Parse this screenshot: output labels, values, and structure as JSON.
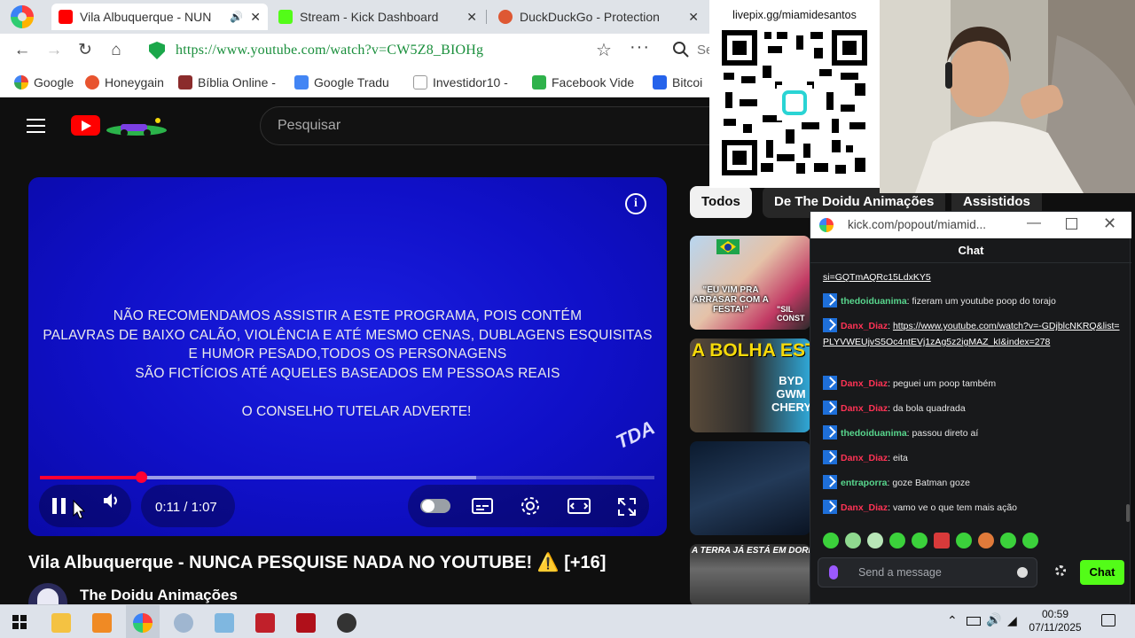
{
  "browser": {
    "tabs": [
      {
        "title": "Vila Albuquerque - NUN"
      },
      {
        "title": "Stream - Kick Dashboard"
      },
      {
        "title": "DuckDuckGo - Protection"
      }
    ],
    "url": "https://www.youtube.com/watch?v=CW5Z8_BIOHg",
    "search_partial": "Se",
    "bookmarks": [
      {
        "label": "Google"
      },
      {
        "label": "Honeygain"
      },
      {
        "label": "Bíblia Online -"
      },
      {
        "label": "Google Tradu"
      },
      {
        "label": "Investidor10 -"
      },
      {
        "label": "Facebook Vide"
      },
      {
        "label": "Bitcoi"
      }
    ]
  },
  "youtube": {
    "search_placeholder": "Pesquisar",
    "video": {
      "disclaimer_lines": [
        "NÃO RECOMENDAMOS ASSISTIR A ESTE PROGRAMA, POIS CONTÉM",
        "PALAVRAS DE BAIXO CALÃO, VIOLÊNCIA E ATÉ MESMO CENAS, DUBLAGENS ESQUISITAS",
        "E HUMOR PESADO,TODOS OS PERSONAGENS",
        "SÃO FICTÍCIOS ATÉ AQUELES BASEADOS EM PESSOAS REAIS"
      ],
      "warning": "O CONSELHO TUTELAR ADVERTE!",
      "watermark": "TDA",
      "time": "0:11 / 1:07",
      "played_fraction": 0.164,
      "buffered_fraction": 0.71
    },
    "title": "Vila Albuquerque - NUNCA PESQUISE NADA NO YOUTUBE! ⚠️ [+16]",
    "channel": "The Doidu Animações",
    "chips": [
      "Todos",
      "De The Doidu Animações",
      "Assistidos"
    ],
    "thumbs": [
      {
        "caption": "\"EU VIM PRA ARRASAR COM A FESTA!\"",
        "side": "\"SIL CONST"
      },
      {
        "caption": "A BOLHA ESTOU",
        "side": "BYD GWM CHERY"
      },
      {
        "caption": ""
      },
      {
        "caption": "A TERRA JÁ ESTÁ EM DORES"
      }
    ]
  },
  "overlay": {
    "qr_label": "livepix.gg/miamidesantos"
  },
  "kick_chat": {
    "url": "kick.com/popout/miamid...",
    "header": "Chat",
    "messages": [
      {
        "user": "",
        "text": "si=GQTmAQRc15LdxKY5",
        "link": true
      },
      {
        "user": "thedoiduanima",
        "text": "fizeram um youtube poop do torajo",
        "color": "green"
      },
      {
        "user": "Danx_Diaz",
        "text": "https://www.youtube.com/watch?v=-GDjblcNKRQ&list=PLYVWEUjvS5Oc4ntEVj1zAg5z2igMAZ_kI&index=278",
        "color": "red",
        "link": true
      },
      {
        "user": "Danx_Diaz",
        "text": "peguei um poop também",
        "color": "red"
      },
      {
        "user": "Danx_Diaz",
        "text": "da bola quadrada",
        "color": "red"
      },
      {
        "user": "thedoiduanima",
        "text": "passou direto aí",
        "color": "green"
      },
      {
        "user": "Danx_Diaz",
        "text": "eita",
        "color": "red"
      },
      {
        "user": "entraporra",
        "text": "goze Batman goze",
        "color": "green"
      },
      {
        "user": "Danx_Diaz",
        "text": "vamo ve o que tem mais ação",
        "color": "red"
      }
    ],
    "input_placeholder": "Send a message",
    "send_label": "Chat"
  },
  "taskbar": {
    "time": "00:59",
    "date": "07/11/2025"
  }
}
